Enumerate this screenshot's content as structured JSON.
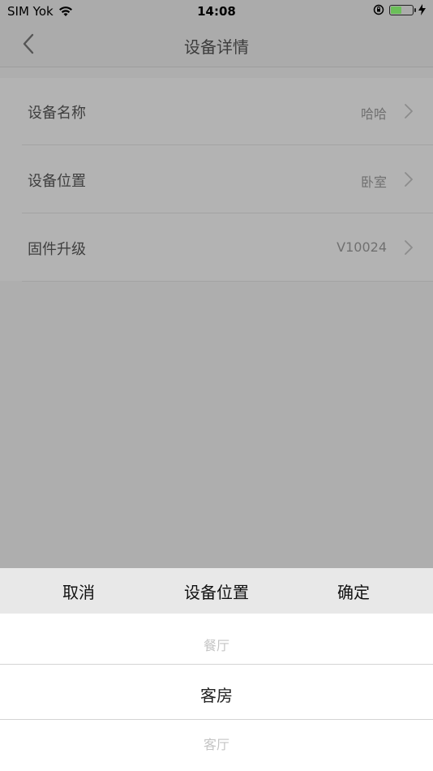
{
  "status_bar": {
    "carrier": "SIM Yok",
    "time": "14:08",
    "battery_level": 0.45,
    "icons": [
      "wifi-icon",
      "rotation-lock-icon",
      "battery-icon",
      "charging-icon"
    ]
  },
  "nav": {
    "title": "设备详情",
    "back_icon": "chevron-left-icon"
  },
  "settings": {
    "rows": [
      {
        "label": "设备名称",
        "value": "哈哈"
      },
      {
        "label": "设备位置",
        "value": "卧室"
      },
      {
        "label": "固件升级",
        "value": "V10024"
      }
    ]
  },
  "picker": {
    "cancel_label": "取消",
    "title": "设备位置",
    "confirm_label": "确定",
    "options": [
      {
        "label": "餐厅"
      },
      {
        "label": "客房",
        "selected": true
      },
      {
        "label": "客厅"
      }
    ]
  },
  "colors": {
    "overlay_dim": "#aeaeae",
    "toolbar_bg": "#e8e8e8",
    "battery_fill": "#6bbf59"
  }
}
